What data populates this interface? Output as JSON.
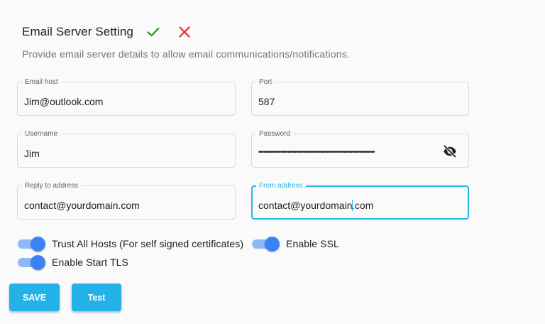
{
  "header": {
    "title": "Email Server Setting",
    "confirm_icon": "check-icon",
    "cancel_icon": "close-icon",
    "confirm_color": "#2e9d2e",
    "cancel_color": "#e53935"
  },
  "subtitle": "Provide email server details to allow email communications/notifications.",
  "fields": {
    "email_host": {
      "label": "Email host",
      "value": "Jim@outlook.com"
    },
    "port": {
      "label": "Port",
      "value": "587"
    },
    "username": {
      "label": "Username",
      "value": "Jim"
    },
    "password": {
      "label": "Password",
      "masked_value": "••••••••••••••••••••••••••••••••••••••••••••••••••••••••••••••••••••",
      "toggle_icon": "eye-off-icon"
    },
    "reply_to": {
      "label": "Reply to address",
      "value": "contact@yourdomain.com"
    },
    "from_address": {
      "label": "From address",
      "value_before_caret": "contact@yourdomain",
      "value_after_caret": ".com",
      "focused": true
    }
  },
  "toggles": {
    "trust_all_hosts": {
      "label": "Trust All Hosts (For self signed certificates)",
      "enabled": true
    },
    "enable_ssl": {
      "label": "Enable SSL",
      "enabled": true
    },
    "enable_start_tls": {
      "label": "Enable Start TLS",
      "enabled": true
    }
  },
  "buttons": {
    "save": "SAVE",
    "test": "Test"
  },
  "colors": {
    "accent": "#22b2e8",
    "focus_border": "#29b6e5",
    "switch_thumb": "#3b82f6",
    "switch_track": "#90b8f8"
  }
}
